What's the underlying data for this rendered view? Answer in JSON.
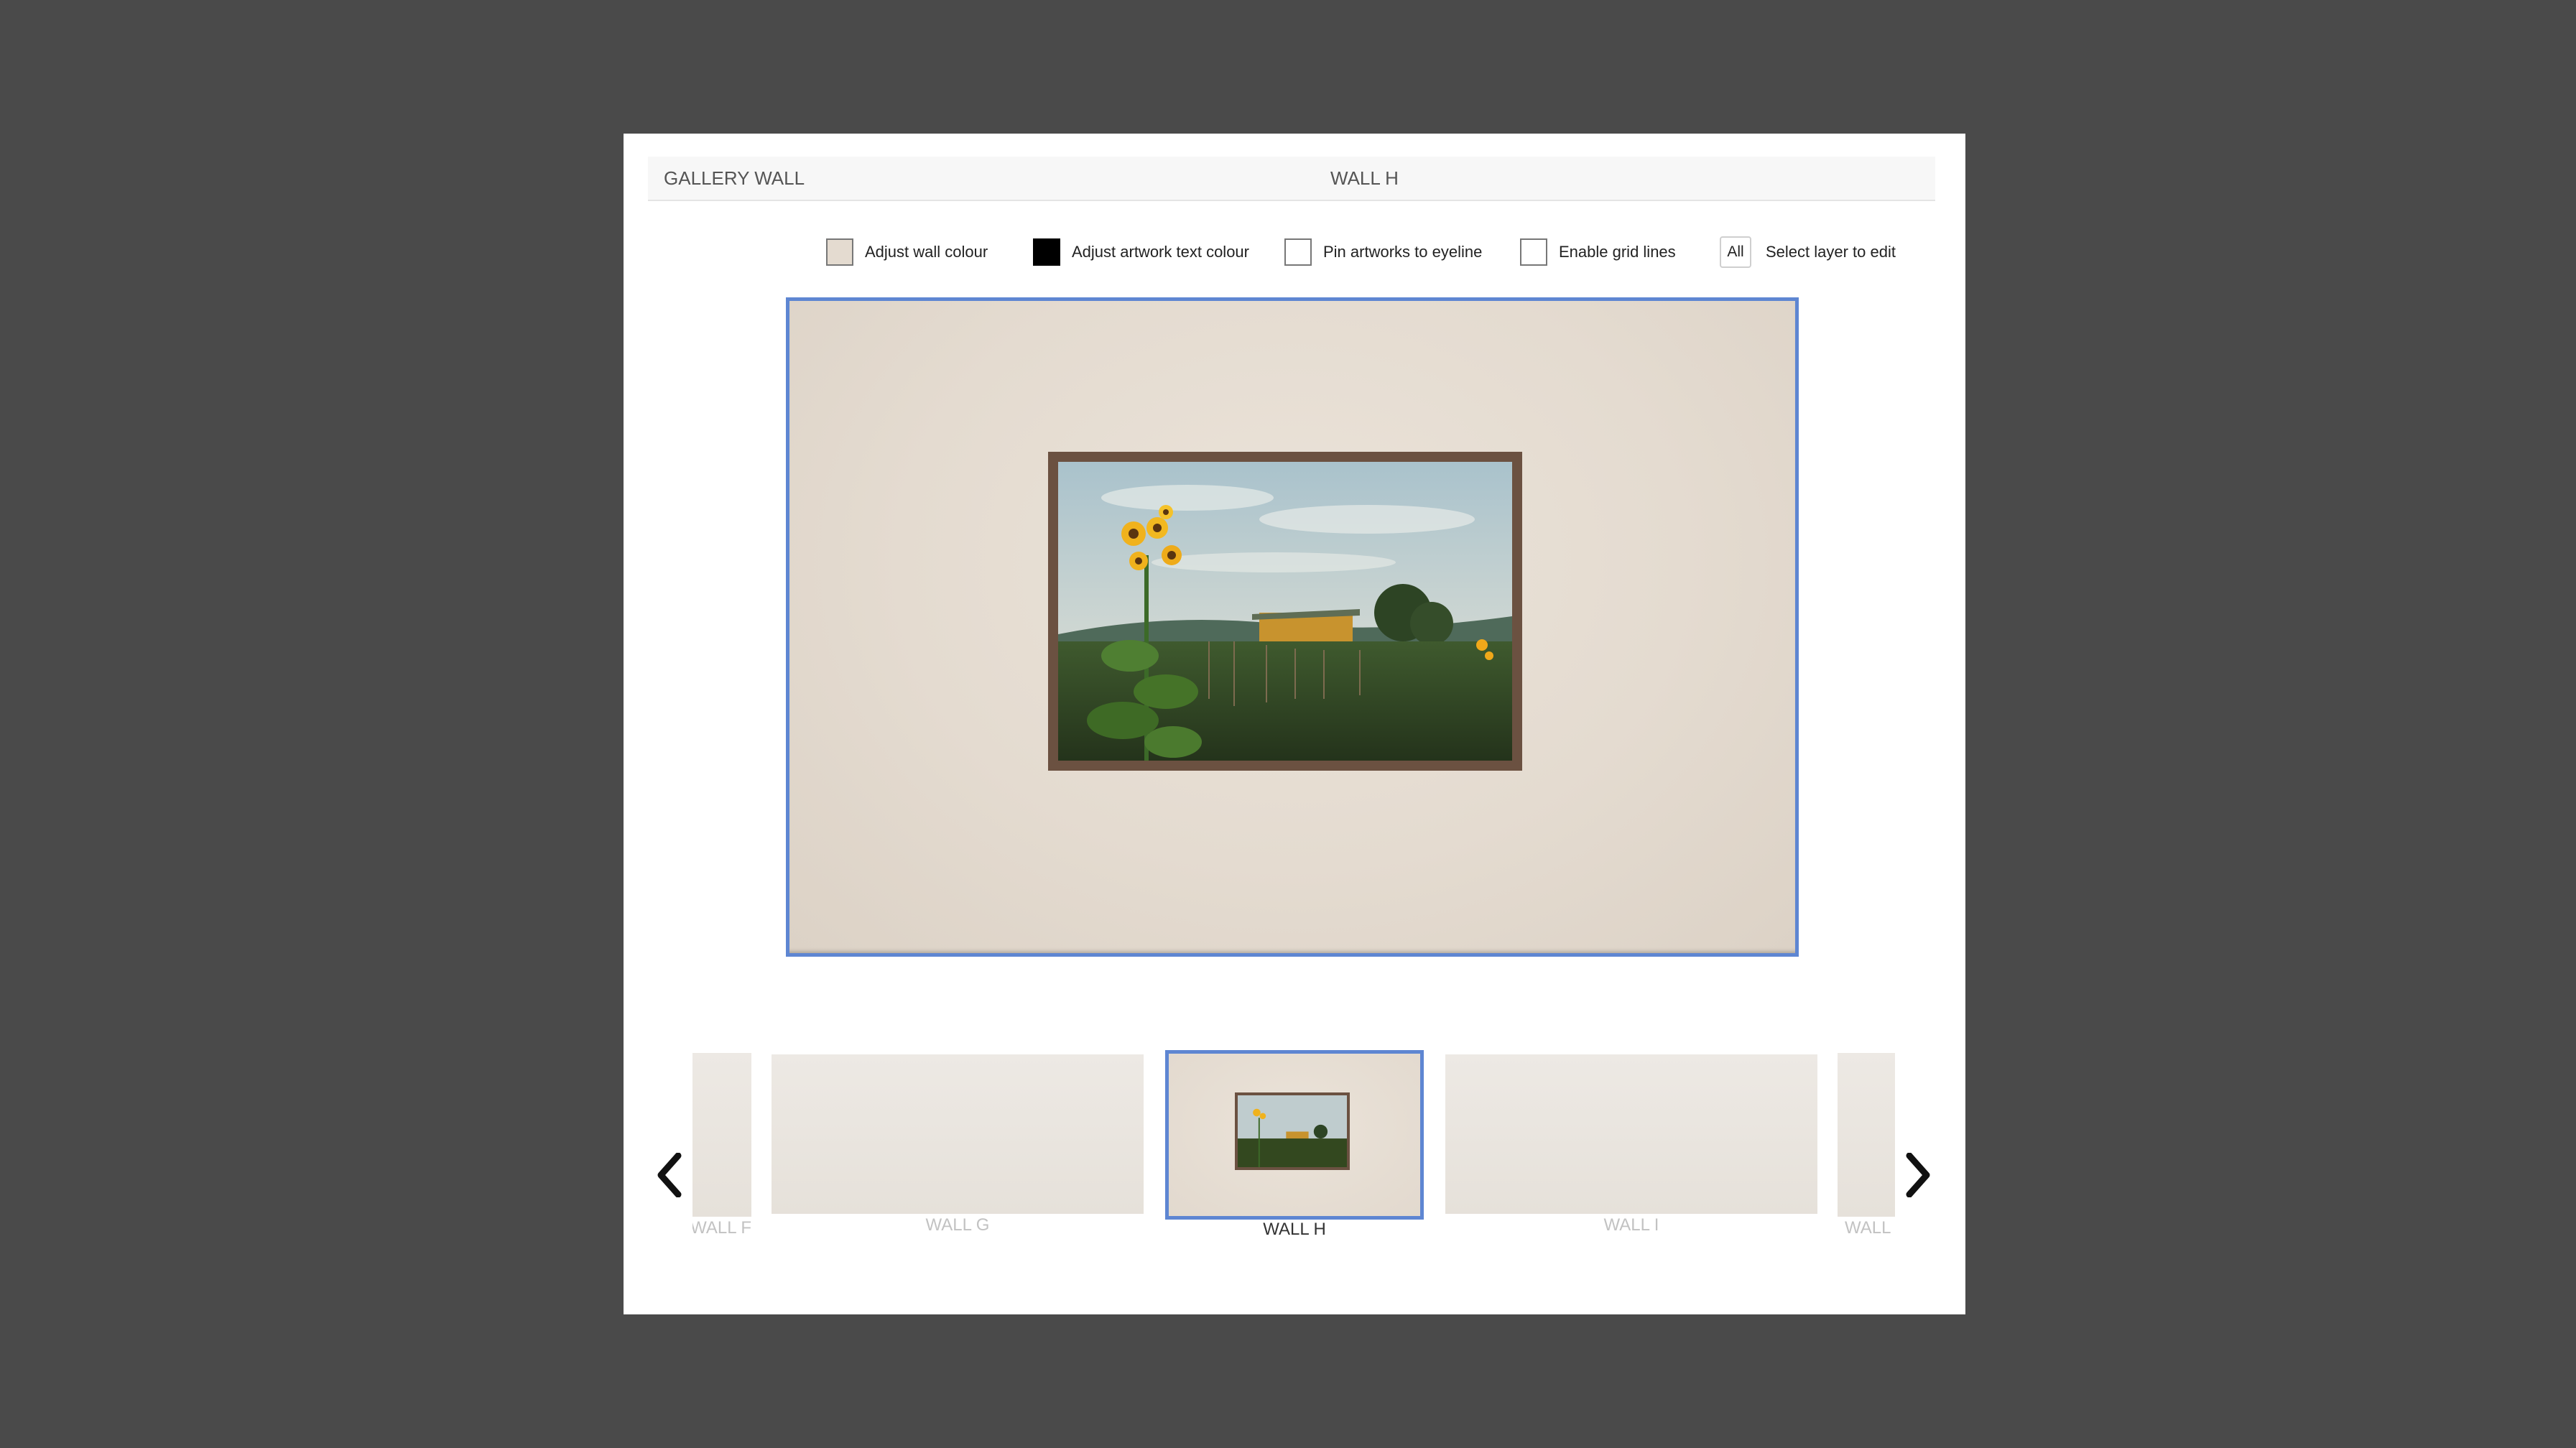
{
  "header": {
    "app_title": "GALLERY WALL",
    "wall_title": "WALL H"
  },
  "toolbar": {
    "wall_colour_label": "Adjust wall colour",
    "wall_colour": "#e4dbd0",
    "text_colour_label": "Adjust artwork text colour",
    "text_colour": "#000000",
    "eyeline_label": "Pin artworks to eyeline",
    "eyeline_checked": false,
    "grid_label": "Enable grid lines",
    "grid_checked": false,
    "layer_value": "All",
    "layer_label": "Select layer to edit"
  },
  "carousel": {
    "prev_icon": "chevron-left-icon",
    "next_icon": "chevron-right-icon",
    "walls": [
      {
        "label": "WALL F",
        "active": false
      },
      {
        "label": "WALL G",
        "active": false
      },
      {
        "label": "WALL H",
        "active": true
      },
      {
        "label": "WALL I",
        "active": false
      },
      {
        "label": "WALL J",
        "active": false
      }
    ]
  },
  "colors": {
    "accent": "#5e86d2",
    "frame": "#6b5141",
    "backdrop": "#4a4a4a"
  }
}
